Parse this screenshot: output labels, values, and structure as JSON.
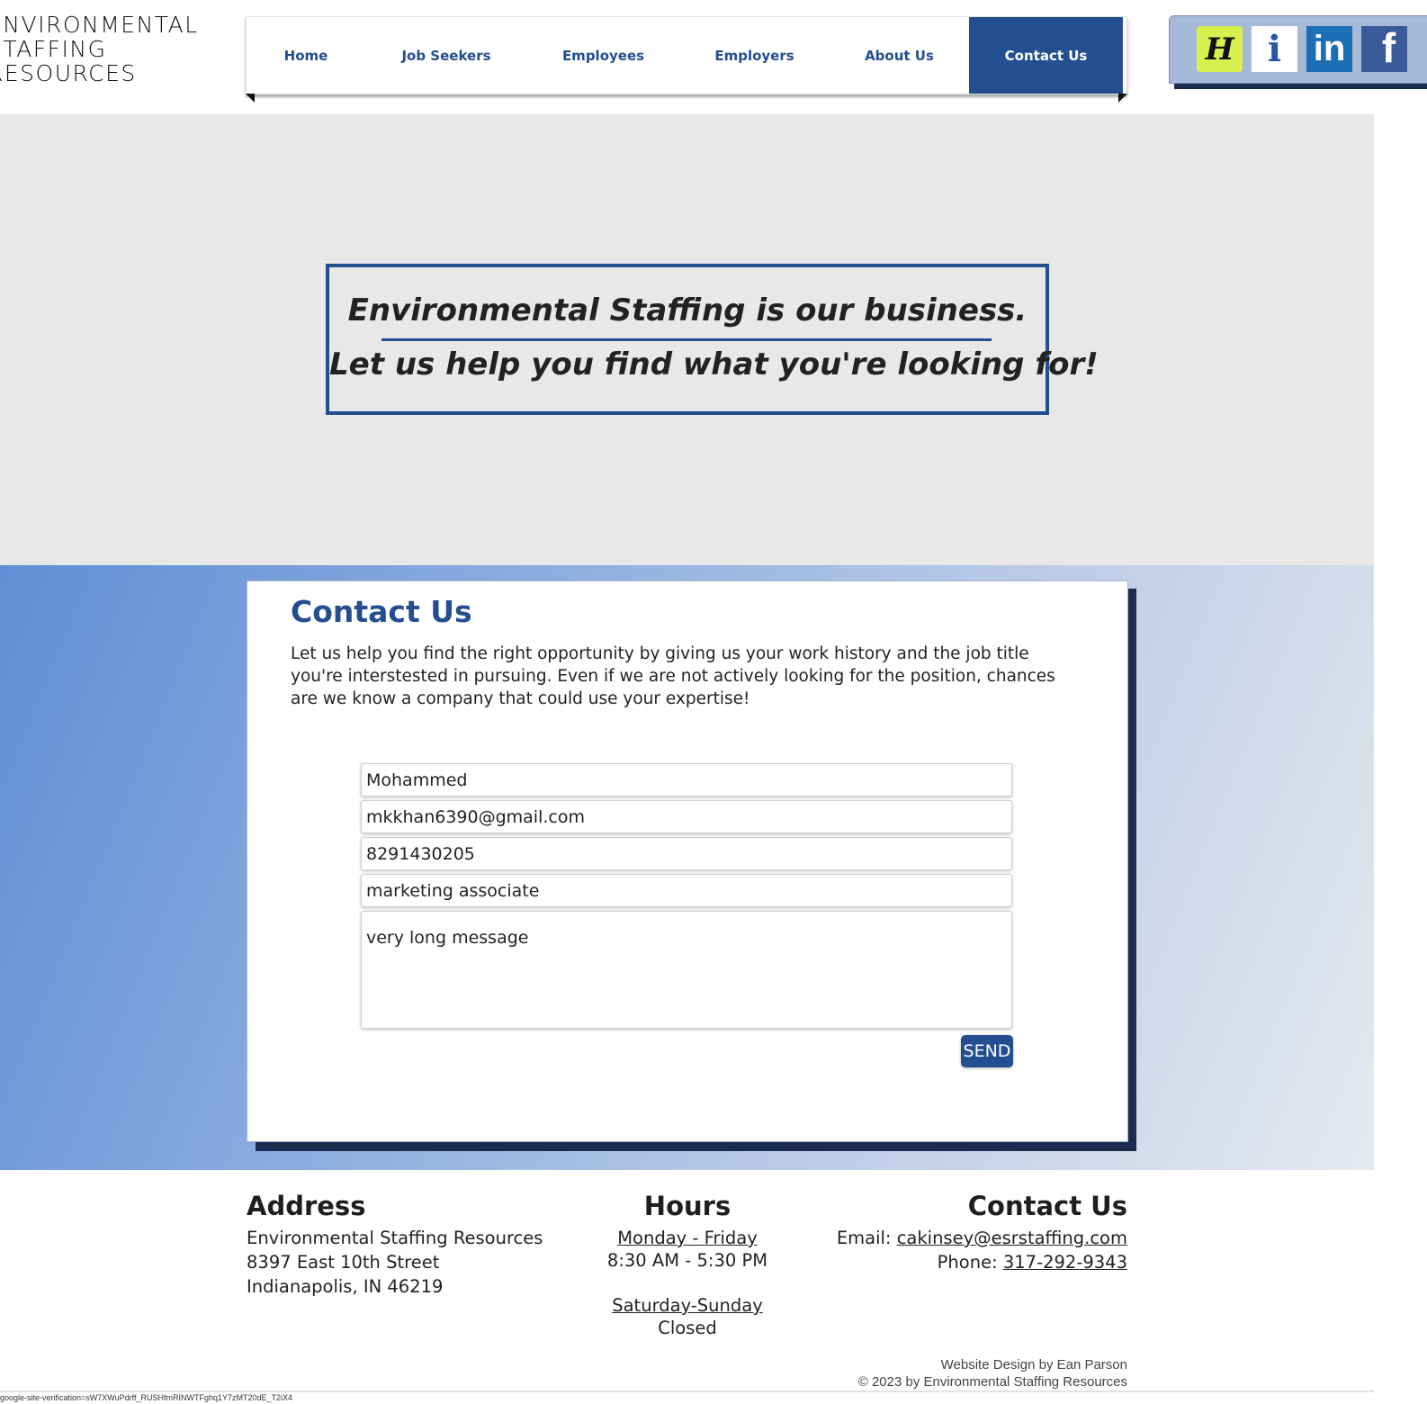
{
  "logo": {
    "lines": [
      "ENVIRONMENTAL",
      "STAFFING",
      "RESOURCES"
    ]
  },
  "nav": {
    "items": [
      {
        "label": "Home"
      },
      {
        "label": "Job Seekers"
      },
      {
        "label": "Employees"
      },
      {
        "label": "Employers"
      },
      {
        "label": "About Us"
      },
      {
        "label": "Contact Us",
        "active": true
      }
    ]
  },
  "social": {
    "icons": [
      {
        "name": "h-icon",
        "glyph": "H"
      },
      {
        "name": "indeed-icon",
        "glyph": "i"
      },
      {
        "name": "linkedin-icon",
        "glyph": "in"
      },
      {
        "name": "facebook-icon",
        "glyph": "f"
      }
    ]
  },
  "hero": {
    "line1": "Environmental Staffing is our business.",
    "line2": "Let us help you find what you're looking for!"
  },
  "contact": {
    "title": "Contact Us",
    "intro": "Let us help you find the right opportunity by giving us your work history and the job title you're interstested in pursuing.  Even if we are not actively looking for the position, chances are we know a company that could use your expertise!",
    "fields": {
      "name": "Mohammed",
      "email": "mkkhan6390@gmail.com",
      "phone": "8291430205",
      "job_title": "marketing associate",
      "message": "very long message"
    },
    "send_label": "SEND"
  },
  "footer": {
    "address": {
      "heading": "Address",
      "lines": [
        "Environmental Staffing Resources",
        "8397 East 10th Street",
        "Indianapolis, IN 46219"
      ]
    },
    "hours": {
      "heading": "Hours",
      "weekday_label": "Monday - Friday",
      "weekday_hours": "8:30 AM - 5:30 PM",
      "weekend_label": "Saturday-Sunday",
      "weekend_hours": "Closed"
    },
    "contact": {
      "heading": "Contact Us",
      "email_label": "Email: ",
      "email": "cakinsey@esrstaffing.com",
      "phone_label": "Phone: ",
      "phone": "317-292-9343"
    },
    "credit": "Website Design by Ean Parson",
    "copyright": "© 2023 by Environmental Staffing Resources",
    "verification": "google-site-verification=sW7XWuPdrff_RUSHfmRINWTFghq1Y7zMT20dE_T2iX4"
  },
  "colors": {
    "brand_blue": "#234e8f",
    "hero_bg": "#e8e8e8",
    "social_bg": "#a7b9d8"
  }
}
